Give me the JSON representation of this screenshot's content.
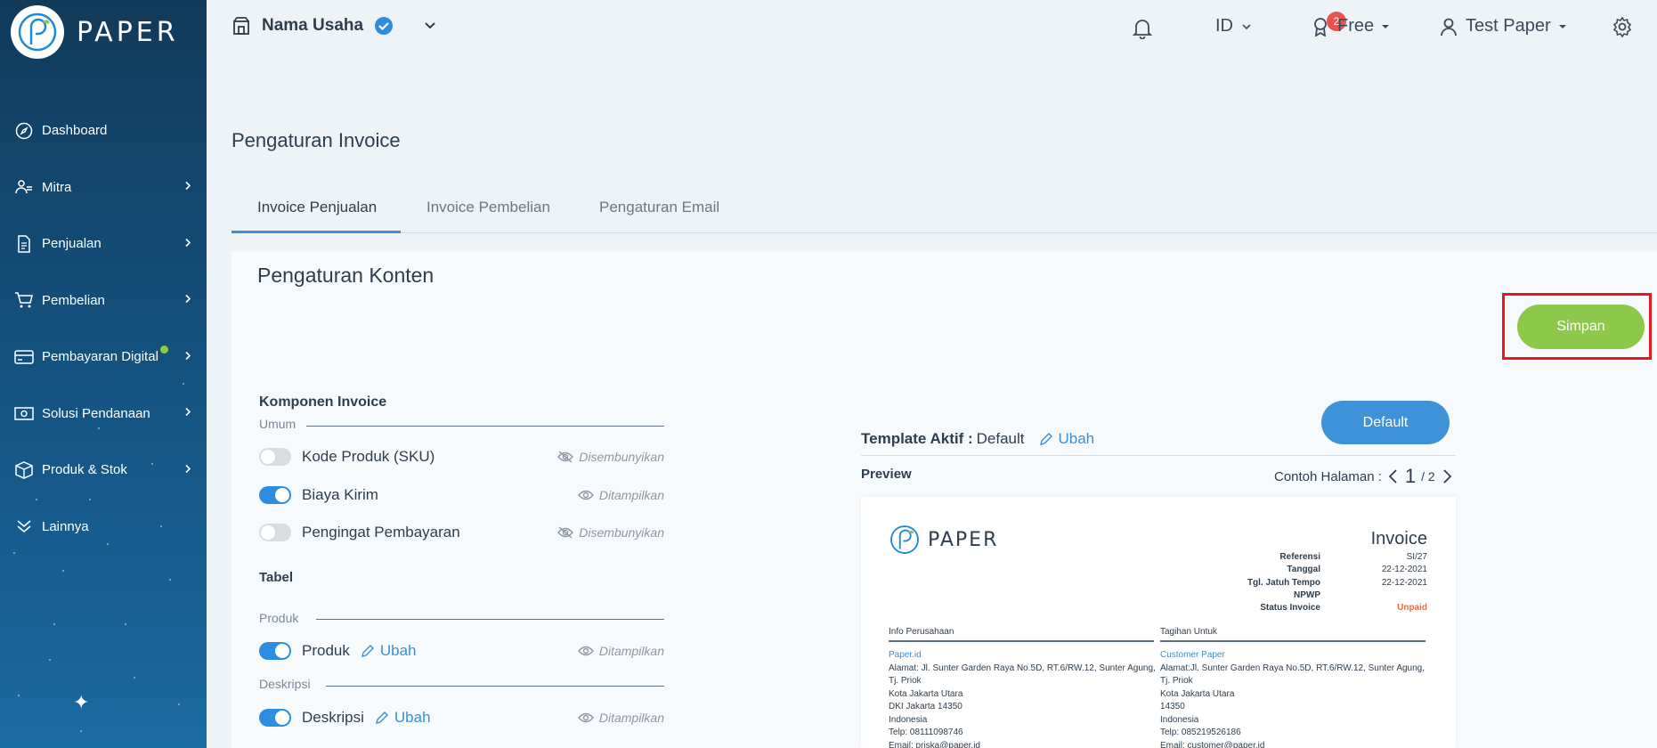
{
  "brand": {
    "name": "PAPER"
  },
  "colors": {
    "accent": "#3a8fd6",
    "save": "#8cc94a",
    "highlight": "#e5191e",
    "unpaid": "#f06a3a"
  },
  "sidebar": {
    "items": [
      {
        "label": "Dashboard",
        "icon": "compass-icon",
        "has_chevron": false
      },
      {
        "label": "Mitra",
        "icon": "users-icon",
        "has_chevron": true
      },
      {
        "label": "Penjualan",
        "icon": "document-icon",
        "has_chevron": true
      },
      {
        "label": "Pembelian",
        "icon": "cart-icon",
        "has_chevron": true
      },
      {
        "label": "Pembayaran Digital",
        "icon": "card-icon",
        "has_chevron": true,
        "dot": true
      },
      {
        "label": "Solusi Pendanaan",
        "icon": "money-icon",
        "has_chevron": true
      },
      {
        "label": "Produk & Stok",
        "icon": "box-icon",
        "has_chevron": true
      },
      {
        "label": "Lainnya",
        "icon": "chevrons-down-icon",
        "has_chevron": false
      }
    ]
  },
  "header": {
    "business_name": "Nama Usaha",
    "notification_count": "2",
    "language": "ID",
    "plan": "Free",
    "user": "Test Paper"
  },
  "page": {
    "title": "Pengaturan Invoice",
    "tabs": [
      {
        "label": "Invoice Penjualan",
        "active": true
      },
      {
        "label": "Invoice Pembelian",
        "active": false
      },
      {
        "label": "Pengaturan Email",
        "active": false
      }
    ],
    "card_title": "Pengaturan Konten",
    "save_label": "Simpan"
  },
  "config": {
    "section_title": "Komponen Invoice",
    "umum_label": "Umum",
    "rows_umum": [
      {
        "label": "Kode Produk (SKU)",
        "on": false,
        "status": "Disembunyikan"
      },
      {
        "label": "Biaya Kirim",
        "on": true,
        "status": "Ditampilkan"
      },
      {
        "label": "Pengingat Pembayaran",
        "on": false,
        "status": "Disembunyikan"
      }
    ],
    "tabel_title": "Tabel",
    "produk_label": "Produk",
    "produk_row": {
      "label": "Produk",
      "on": true,
      "edit": "Ubah",
      "status": "Ditampilkan"
    },
    "deskripsi_label": "Deskripsi",
    "deskripsi_row": {
      "label": "Deskripsi",
      "on": true,
      "edit": "Ubah",
      "status": "Ditampilkan"
    }
  },
  "preview": {
    "template_label": "Template Aktif :",
    "template_value": "Default",
    "template_edit": "Ubah",
    "default_button": "Default",
    "preview_label": "Preview",
    "page_label": "Contoh Halaman :",
    "page_current": "1",
    "page_total": "/ 2",
    "invoice": {
      "logo_text": "PAPER",
      "title": "Invoice",
      "meta": [
        {
          "k": "Referensi",
          "v": "SI/27"
        },
        {
          "k": "Tanggal",
          "v": "22-12-2021"
        },
        {
          "k": "Tgl. Jatuh Tempo",
          "v": "22-12-2021"
        },
        {
          "k": "NPWP",
          "v": ""
        },
        {
          "k": "Status Invoice",
          "v": "Unpaid"
        }
      ],
      "from_heading": "Info Perusahaan",
      "to_heading": "Tagihan Untuk",
      "from": {
        "name": "Paper.id",
        "lines": [
          "Alamat: Jl. Sunter Garden Raya No.5D, RT.6/RW.12, Sunter Agung,",
          "Tj. Priok",
          "Kota Jakarta Utara",
          "DKI Jakarta 14350",
          "Indonesia",
          "Telp: 08111098746",
          "Email: priska@paper.id"
        ]
      },
      "to": {
        "name": "Customer Paper",
        "lines": [
          "Alamat:Jl. Sunter Garden Raya No.5D, RT.6/RW.12, Sunter Agung,",
          "Tj. Priok",
          "Kota Jakarta Utara",
          "14350",
          "Indonesia",
          "Telp: 085219526186",
          "Email: customer@paper.id"
        ]
      }
    }
  }
}
